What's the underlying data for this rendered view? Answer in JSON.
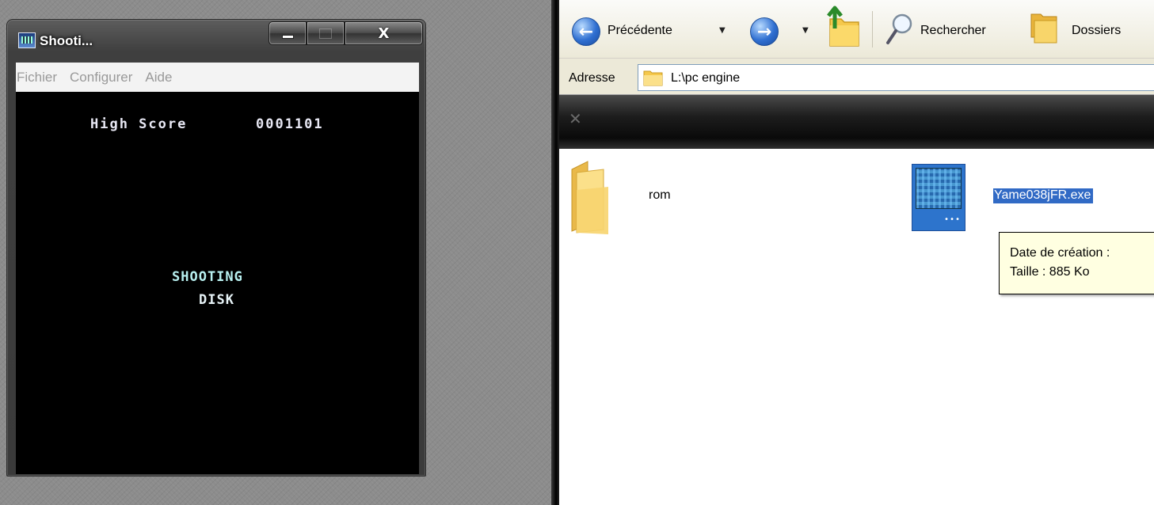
{
  "emulator": {
    "title": "Shooti...",
    "buttons": {
      "minimize": "",
      "maximize": "",
      "close": "X"
    },
    "menu": [
      "Fichier",
      "Configurer",
      "Aide"
    ],
    "screen": {
      "high_score_label": "High Score",
      "high_score_value": "0001101",
      "game_title_line1": "SHOOTING",
      "game_title_line2": "DISK"
    }
  },
  "explorer": {
    "toolbar": {
      "back_label": "Précédente",
      "search_label": "Rechercher",
      "folders_label": "Dossiers"
    },
    "address": {
      "label": "Adresse",
      "value": "L:\\pc engine"
    },
    "files": [
      {
        "name": "rom",
        "type": "folder"
      },
      {
        "name": "Yame038jFR.exe",
        "type": "executable",
        "selected": true
      }
    ],
    "tooltip": {
      "line1": "Date de création :",
      "line2": "Taille  : 885 Ko"
    }
  },
  "colors": {
    "desktop_gray": "#8c8c8c",
    "selection_blue": "#316ac5",
    "tooltip_bg": "#ffffe1",
    "game_text_cyan": "#b8f0f0"
  }
}
